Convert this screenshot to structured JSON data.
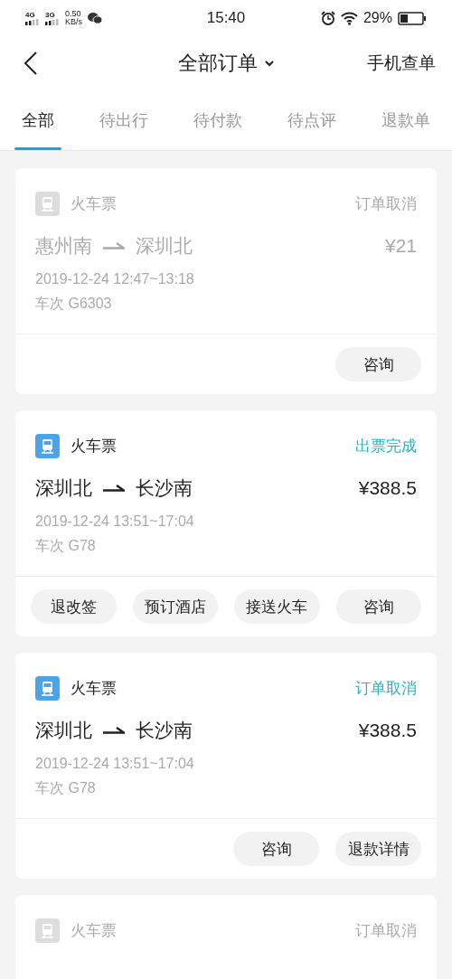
{
  "status_bar": {
    "networks": [
      "4G",
      "3G"
    ],
    "speed": "0.50",
    "speed_unit": "KB/s",
    "time": "15:40",
    "battery": "29%"
  },
  "header": {
    "title": "全部订单",
    "action": "手机查单"
  },
  "tabs": [
    {
      "label": "全部",
      "selected": true
    },
    {
      "label": "待出行",
      "selected": false
    },
    {
      "label": "待付款",
      "selected": false
    },
    {
      "label": "待点评",
      "selected": false
    },
    {
      "label": "退款单",
      "selected": false
    }
  ],
  "orders": [
    {
      "type": "火车票",
      "status": "订单取消",
      "disabled": true,
      "from": "惠州南",
      "to": "深圳北",
      "price": "¥21",
      "time": "2019-12-24 12:47~13:18",
      "train": "车次 G6303",
      "buttons": [
        "咨询"
      ]
    },
    {
      "type": "火车票",
      "status": "出票完成",
      "disabled": false,
      "from": "深圳北",
      "to": "长沙南",
      "price": "¥388.5",
      "time": "2019-12-24 13:51~17:04",
      "train": "车次 G78",
      "buttons": [
        "退改签",
        "预订酒店",
        "接送火车",
        "咨询"
      ]
    },
    {
      "type": "火车票",
      "status": "订单取消",
      "disabled": false,
      "from": "深圳北",
      "to": "长沙南",
      "price": "¥388.5",
      "time": "2019-12-24 13:51~17:04",
      "train": "车次 G78",
      "buttons": [
        "咨询",
        "退款详情"
      ]
    },
    {
      "type": "火车票",
      "status": "订单取消",
      "disabled": true
    }
  ]
}
